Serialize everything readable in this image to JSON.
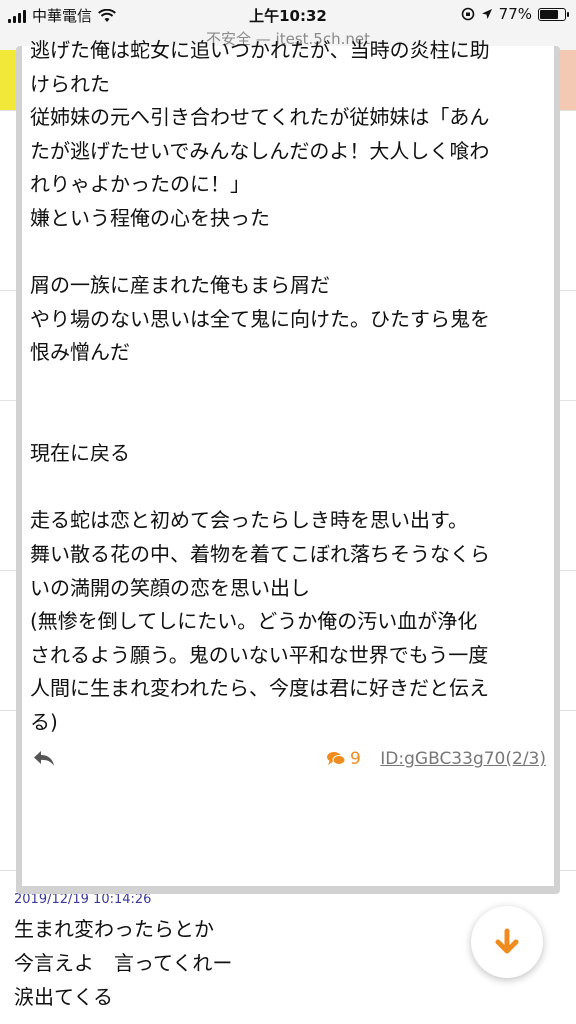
{
  "status_bar": {
    "carrier": "中華電信",
    "time": "上午10:32",
    "battery_percent": "77%",
    "battery_level": 0.77
  },
  "browser": {
    "url_text": "不安全 — itest.5ch.net"
  },
  "popup": {
    "lines": [
      "逃げた俺は蛇女に追いつかれたが、当時の炎柱に助",
      "けられた",
      "従姉妹の元へ引き合わせてくれたが従姉妹は「あん",
      "たが逃げたせいでみんなしんだのよ！大人しく喰わ",
      "れりゃよかったのに！」",
      "嫌という程俺の心を抉った",
      "",
      "屑の一族に産まれた俺もまら屑だ",
      "やり場のない思いは全て鬼に向けた。ひたすら鬼を",
      "恨み憎んだ",
      "",
      "",
      "現在に戻る",
      "",
      "走る蛇は恋と初めて会ったらしき時を思い出す。",
      "舞い散る花の中、着物を着てこぼれ落ちそうなくら",
      "いの満開の笑顔の恋を思い出し",
      "(無惨を倒してしにたい。どうか俺の汚い血が浄化",
      "されるよう願う。鬼のいない平和な世界でもう一度",
      "人間に生まれ変われたら、今度は君に好きだと伝え",
      "る)"
    ],
    "reply_count": "9",
    "post_id": "ID:gGBC33g70(2/3)"
  },
  "underlying": {
    "date": "2019/12/19 10:14:26",
    "lines": [
      "生まれ変わったらとか",
      "今言えよ　言ってくれー",
      "涙出てくる"
    ]
  },
  "colors": {
    "accent_orange": "#f08c1e",
    "date_blue": "#3a3a9a"
  },
  "icons": {
    "reply": "reply-arrow-icon",
    "comment": "comment-bubble-icon",
    "fab": "down-arrow-icon"
  }
}
